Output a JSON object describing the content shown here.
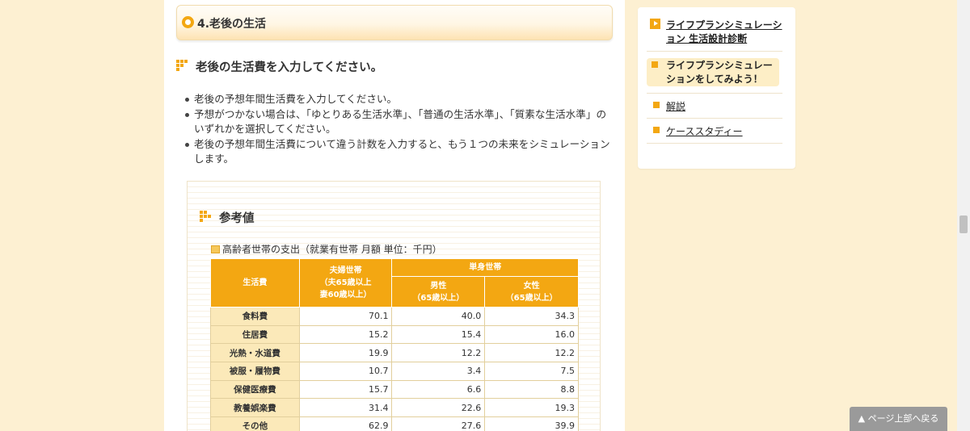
{
  "section": {
    "title": "4.老後の生活"
  },
  "main": {
    "heading": "老後の生活費を入力してください。",
    "bullets": [
      "老後の予想年間生活費を入力してください。",
      "予想がつかない場合は、「ゆとりある生活水準」、「普通の生活水準」、「質素な生活水準」のいずれかを選択してください。",
      "老後の予想年間生活費について違う計数を入力すると、もう１つの未来をシミュレーションします。"
    ]
  },
  "reference": {
    "title": "参考値",
    "caption": "高齢者世帯の支出（就業有世帯 月額 単位：千円）",
    "table": {
      "header_category": "生活費",
      "header_couple": "夫婦世帯\n（夫65歳以上\n妻60歳以上）",
      "header_single": "単身世帯",
      "header_male": "男性\n（65歳以上）",
      "header_female": "女性\n（65歳以上）",
      "rows": [
        {
          "label": "食料費",
          "couple": "70.1",
          "male": "40.0",
          "female": "34.3"
        },
        {
          "label": "住居費",
          "couple": "15.2",
          "male": "15.4",
          "female": "16.0"
        },
        {
          "label": "光熱・水道費",
          "couple": "19.9",
          "male": "12.2",
          "female": "12.2"
        },
        {
          "label": "被服・履物費",
          "couple": "10.7",
          "male": "3.4",
          "female": "7.5"
        },
        {
          "label": "保健医療費",
          "couple": "15.7",
          "male": "6.6",
          "female": "8.8"
        },
        {
          "label": "教養娯楽費",
          "couple": "31.4",
          "male": "22.6",
          "female": "19.3"
        },
        {
          "label": "その他",
          "couple": "62.9",
          "male": "27.6",
          "female": "39.9"
        }
      ]
    }
  },
  "sidebar": {
    "items": [
      {
        "label": "ライフプランシミュレーション 生活設計診断"
      },
      {
        "label": "ライフプランシミュレーションをしてみよう！"
      },
      {
        "label": "解説"
      },
      {
        "label": "ケーススタディー"
      }
    ]
  },
  "back_to_top": "▲ ページ上部へ戻る",
  "colors": {
    "accent": "#f3a712",
    "page_bg": "#fdf0d2",
    "row_head_bg": "#fbe9b9"
  }
}
